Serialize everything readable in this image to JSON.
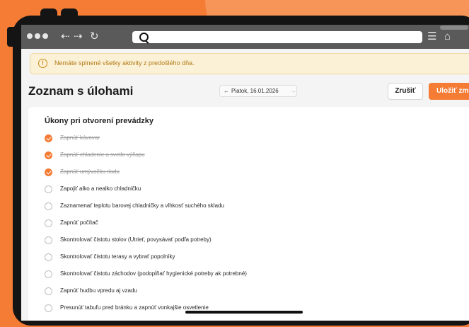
{
  "browser": {
    "url": ""
  },
  "alert": {
    "text": "Nemáte splnené všetky aktivity z predošlého dňa."
  },
  "page": {
    "title": "Zoznam s úlohami",
    "date": "Piatok, 16.01.2026",
    "prev_arrow": "←",
    "next_arrow": "→",
    "cancel_label": "Zrušiť",
    "save_label": "Uložiť zmeny"
  },
  "section": {
    "title": "Úkony pri otvorení prevádzky",
    "tasks": [
      {
        "label": "Zapnúť kávovar",
        "done": true
      },
      {
        "label": "Zapnúť chladenie a svetlo výčapu",
        "done": true
      },
      {
        "label": "Zapnúť umývačku riadu",
        "done": true
      },
      {
        "label": "Zapojiť alko a nealko chladničku",
        "done": false
      },
      {
        "label": "Zaznamenať teplotu barovej chladničky a vlhkosť suchého skladu",
        "done": false
      },
      {
        "label": "Zapnúť počítač",
        "done": false
      },
      {
        "label": "Skontrolovať čistotu stolov (Utrieť, povysávať podľa potreby)",
        "done": false
      },
      {
        "label": "Skontrolovať čistotu terasy a vybrať popolníky",
        "done": false
      },
      {
        "label": "Skontrolovať čistotu záchodov (podopĺňať hygienické potreby ak potrebné)",
        "done": false
      },
      {
        "label": "Zapnúť hudbu vpredu aj vzadu",
        "done": false
      },
      {
        "label": "Presunúť tabuľu pred bránku a zapnúť vonkajšie osvetlenie",
        "done": false
      }
    ]
  },
  "colors": {
    "accent": "#f47c35",
    "background": "#f47c35",
    "alert_bg": "#fbf1d6",
    "alert_text": "#b27a14"
  },
  "icons": {
    "dots": "window-dots-icon",
    "back": "back-arrow-icon",
    "forward": "forward-arrow-icon",
    "reload": "reload-icon",
    "search": "search-icon",
    "menu": "menu-icon",
    "home": "home-icon",
    "alert": "warning-icon"
  }
}
